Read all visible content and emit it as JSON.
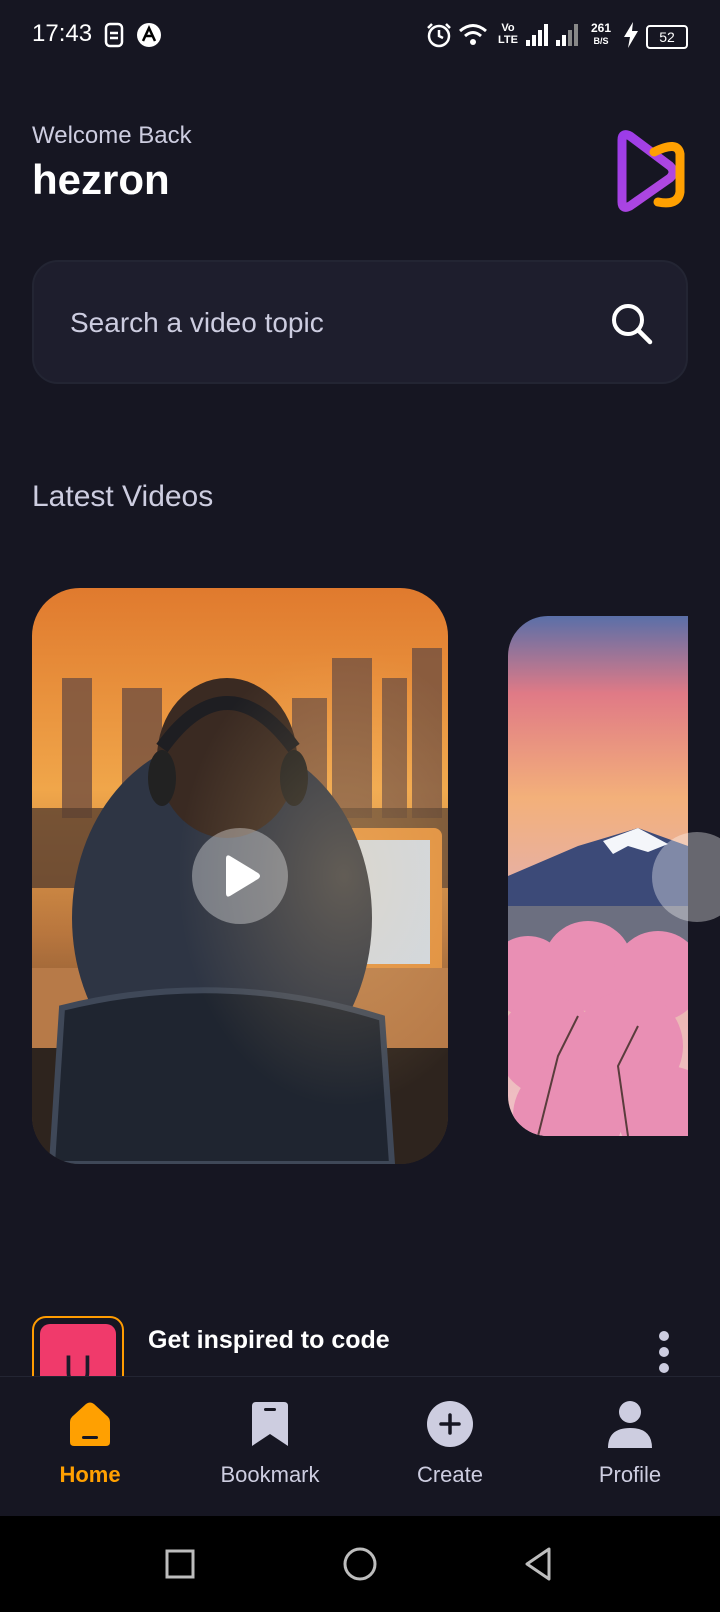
{
  "status_bar": {
    "time": "17:43",
    "network_speed": "261",
    "network_speed_unit": "B/S",
    "battery": "52",
    "volte": "Vo LTE",
    "icons": [
      "sim-icon",
      "app-notification-icon",
      "alarm-icon",
      "wifi-icon",
      "volte-icon",
      "signal-icon",
      "signal-icon-2",
      "charging-icon",
      "battery-icon"
    ]
  },
  "header": {
    "welcome": "Welcome Back",
    "username": "hezron"
  },
  "search": {
    "placeholder": "Search a video topic"
  },
  "latest": {
    "title": "Latest Videos"
  },
  "video_item": {
    "title": "Get inspired to code",
    "thumb_letter": "U"
  },
  "tabs": [
    {
      "label": "Home",
      "active": true
    },
    {
      "label": "Bookmark",
      "active": false
    },
    {
      "label": "Create",
      "active": false
    },
    {
      "label": "Profile",
      "active": false
    }
  ],
  "colors": {
    "background": "#161622",
    "accent": "#FFA001",
    "card": "#1E1E2D",
    "muted_text": "#CDCDE0"
  }
}
